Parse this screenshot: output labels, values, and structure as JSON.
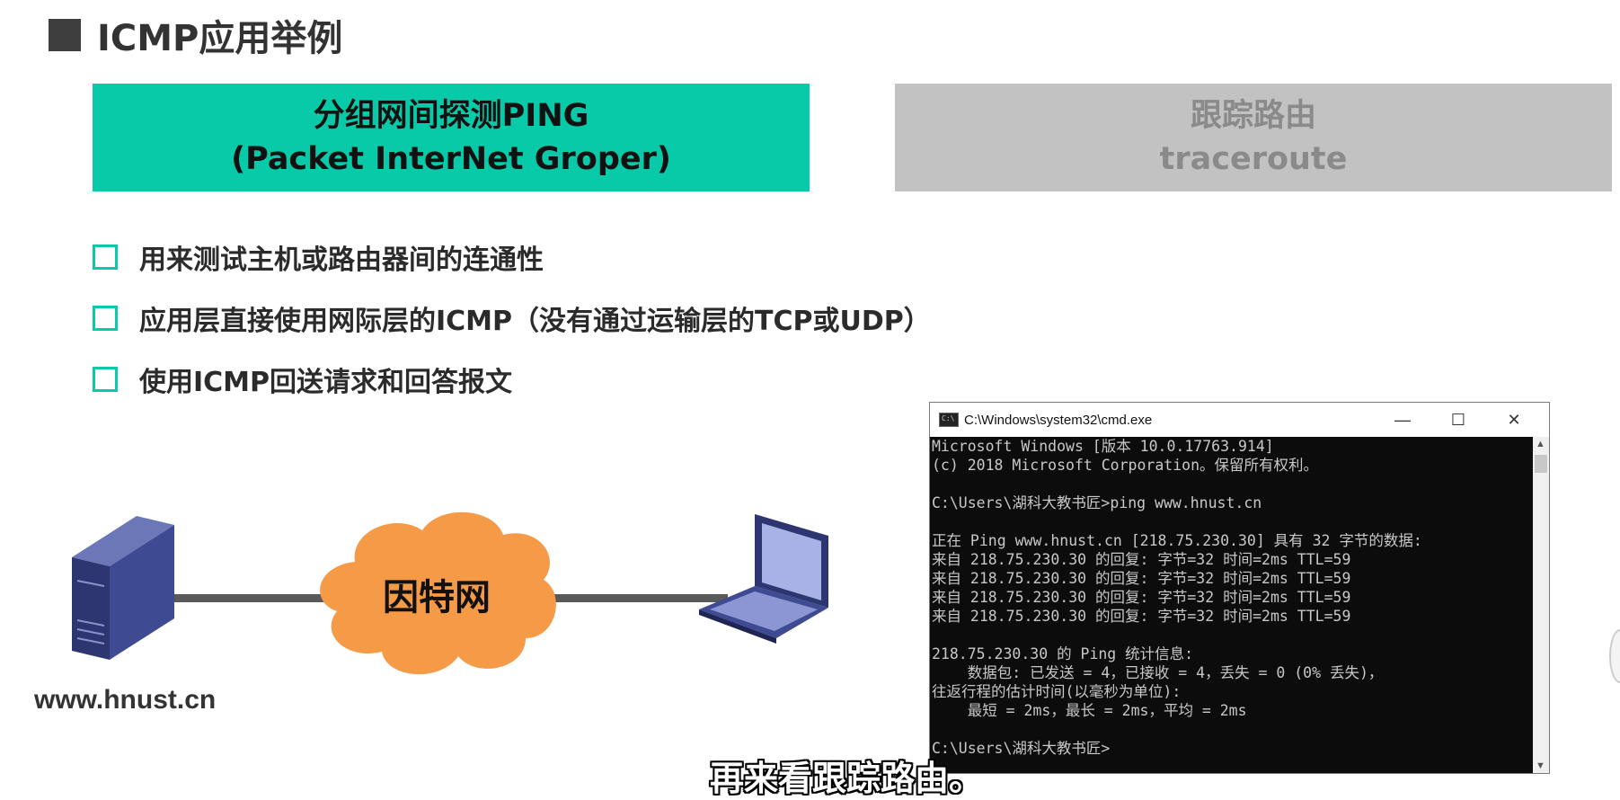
{
  "slide": {
    "heading": "ICMP应用举例",
    "ping_box": {
      "line1": "分组网间探测PING",
      "line2": "(Packet InterNet Groper)"
    },
    "trace_box": {
      "line1": "跟踪路由",
      "line2": "traceroute"
    },
    "bullets": [
      "用来测试主机或路由器间的连通性",
      "应用层直接使用网际层的ICMP（没有通过运输层的TCP或UDP）",
      "使用ICMP回送请求和回答报文"
    ],
    "diagram": {
      "host_label": "www.hnust.cn",
      "cloud_label": "因特网"
    },
    "colors": {
      "accent": "#08c9a8",
      "inactive": "#c2c2c2",
      "cloud": "#f59a47",
      "server": "#3a4480"
    }
  },
  "cmd_window": {
    "title": "C:\\Windows\\system32\\cmd.exe",
    "minimize_glyph": "—",
    "maximize_glyph": "☐",
    "close_glyph": "✕",
    "lines": [
      "Microsoft Windows [版本 10.0.17763.914]",
      "(c) 2018 Microsoft Corporation。保留所有权利。",
      "",
      "C:\\Users\\湖科大教书匠>ping www.hnust.cn",
      "",
      "正在 Ping www.hnust.cn [218.75.230.30] 具有 32 字节的数据:",
      "来自 218.75.230.30 的回复: 字节=32 时间=2ms TTL=59",
      "来自 218.75.230.30 的回复: 字节=32 时间=2ms TTL=59",
      "来自 218.75.230.30 的回复: 字节=32 时间=2ms TTL=59",
      "来自 218.75.230.30 的回复: 字节=32 时间=2ms TTL=59",
      "",
      "218.75.230.30 的 Ping 统计信息:",
      "    数据包: 已发送 = 4，已接收 = 4，丢失 = 0 (0% 丢失)，",
      "往返行程的估计时间(以毫秒为单位):",
      "    最短 = 2ms，最长 = 2ms，平均 = 2ms",
      "",
      "C:\\Users\\湖科大教书匠>"
    ]
  },
  "subtitle": "再来看跟踪路由。"
}
